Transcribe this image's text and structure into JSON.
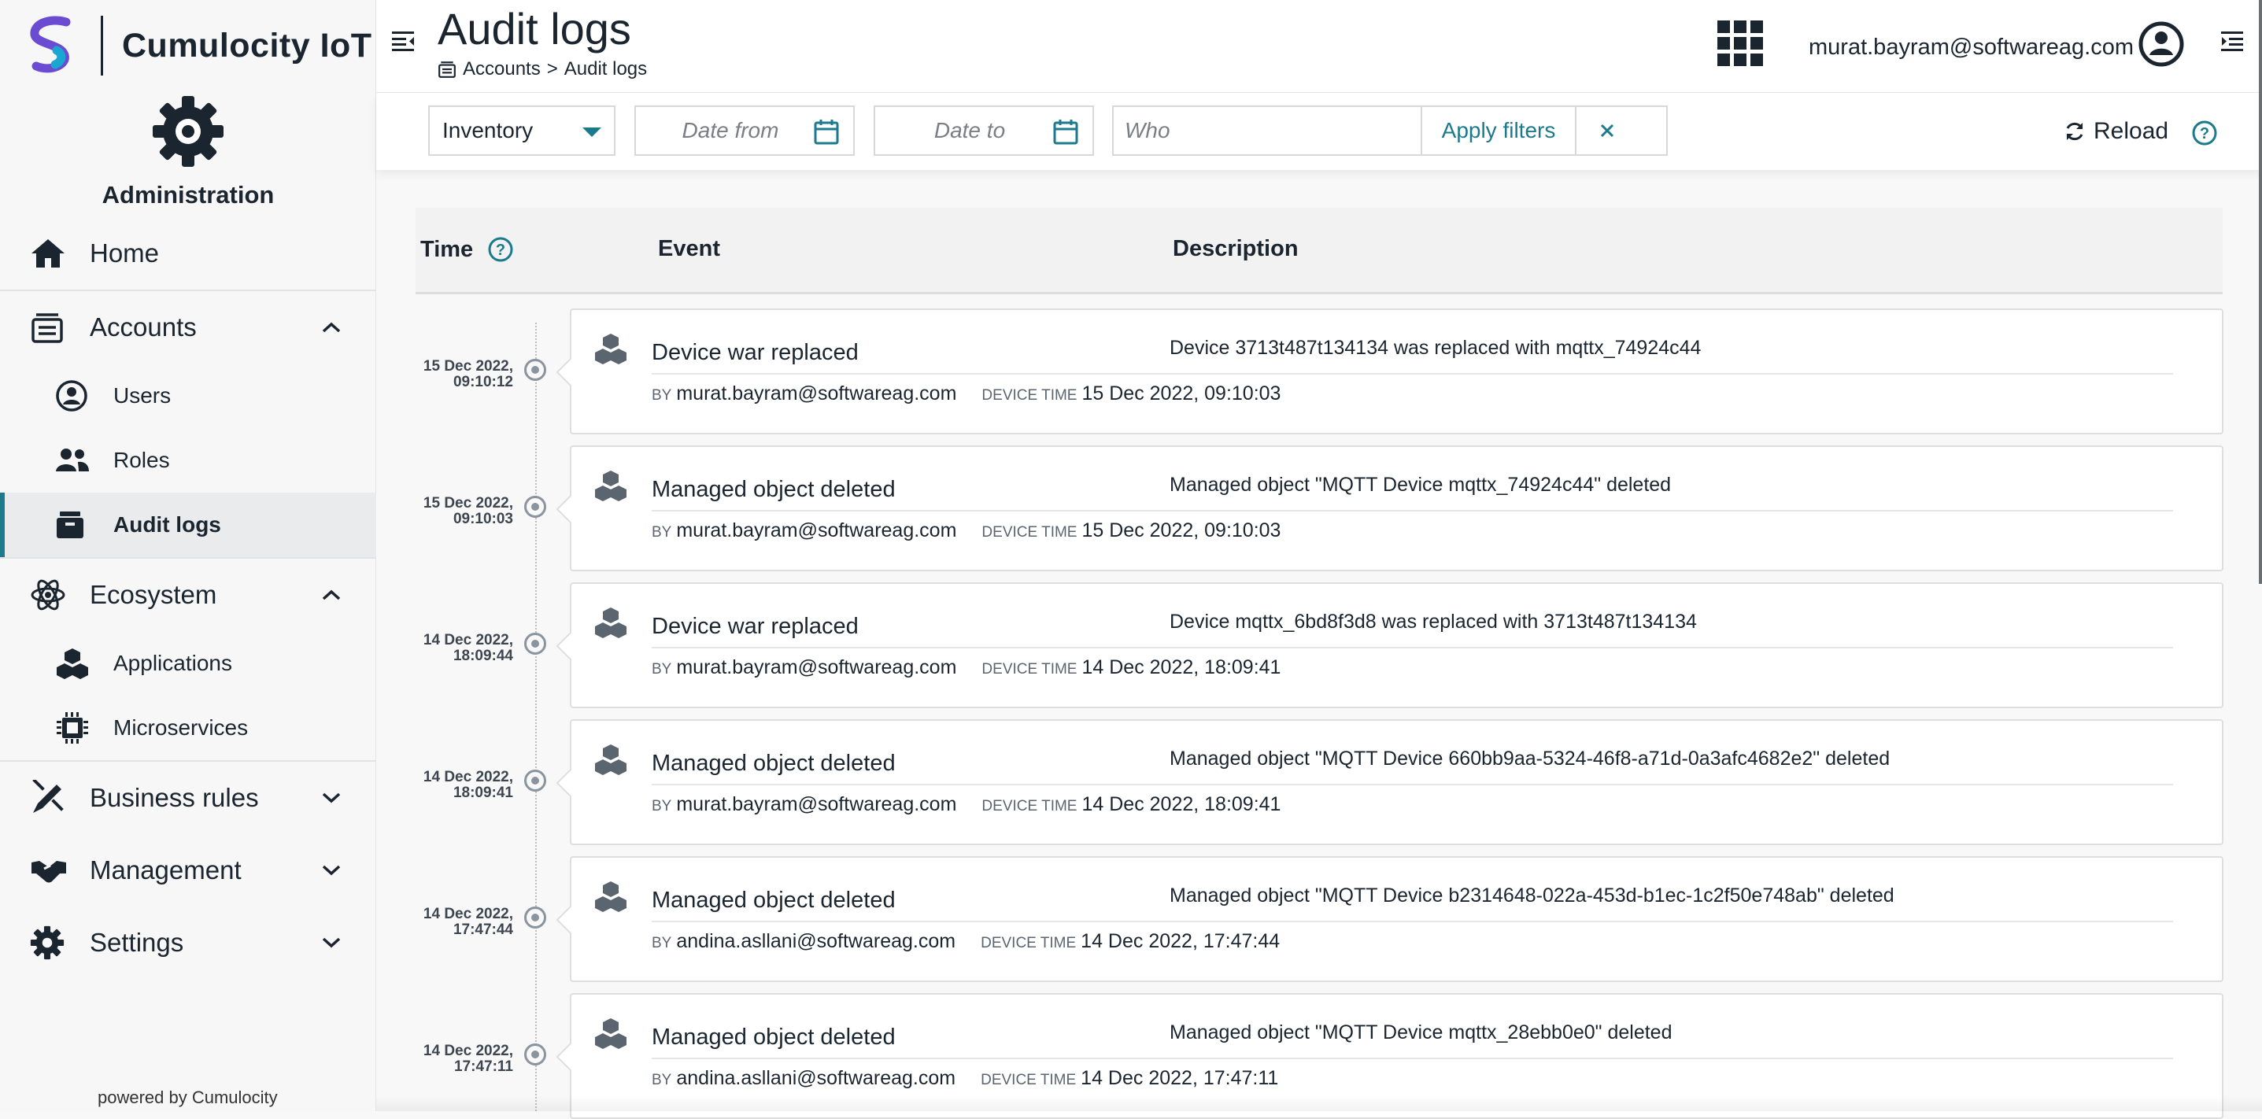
{
  "brand": {
    "name": "Cumulocity IoT",
    "app_name": "Administration",
    "powered_by": "powered by Cumulocity"
  },
  "nav": {
    "home": "Home",
    "accounts": "Accounts",
    "users": "Users",
    "roles": "Roles",
    "audit_logs": "Audit logs",
    "ecosystem": "Ecosystem",
    "applications": "Applications",
    "microservices": "Microservices",
    "business_rules": "Business rules",
    "management": "Management",
    "settings": "Settings"
  },
  "header": {
    "title": "Audit logs",
    "breadcrumb_parent": "Accounts",
    "breadcrumb_sep": ">",
    "breadcrumb_current": "Audit logs",
    "user_email": "murat.bayram@softwareag.com"
  },
  "filters": {
    "type_value": "Inventory",
    "date_from_placeholder": "Date from",
    "date_to_placeholder": "Date to",
    "who_placeholder": "Who",
    "apply_label": "Apply filters",
    "reload_label": "Reload"
  },
  "table": {
    "col_time": "Time",
    "col_event": "Event",
    "col_description": "Description",
    "by_label": "BY",
    "device_time_label": "DEVICE TIME",
    "rows": [
      {
        "date": "15 Dec 2022,",
        "time": "09:10:12",
        "event": "Device war replaced",
        "description": "Device 3713t487t134134 was replaced with mqttx_74924c44",
        "by": "murat.bayram@softwareag.com",
        "device_time": "15 Dec 2022, 09:10:03"
      },
      {
        "date": "15 Dec 2022,",
        "time": "09:10:03",
        "event": "Managed object deleted",
        "description": "Managed object \"MQTT Device mqttx_74924c44\" deleted",
        "by": "murat.bayram@softwareag.com",
        "device_time": "15 Dec 2022, 09:10:03"
      },
      {
        "date": "14 Dec 2022,",
        "time": "18:09:44",
        "event": "Device war replaced",
        "description": "Device mqttx_6bd8f3d8 was replaced with 3713t487t134134",
        "by": "murat.bayram@softwareag.com",
        "device_time": "14 Dec 2022, 18:09:41"
      },
      {
        "date": "14 Dec 2022,",
        "time": "18:09:41",
        "event": "Managed object deleted",
        "description": "Managed object \"MQTT Device 660bb9aa-5324-46f8-a71d-0a3afc4682e2\" deleted",
        "by": "murat.bayram@softwareag.com",
        "device_time": "14 Dec 2022, 18:09:41"
      },
      {
        "date": "14 Dec 2022,",
        "time": "17:47:44",
        "event": "Managed object deleted",
        "description": "Managed object \"MQTT Device b2314648-022a-453d-b1ec-1c2f50e748ab\" deleted",
        "by": "andina.asllani@softwareag.com",
        "device_time": "14 Dec 2022, 17:47:44"
      },
      {
        "date": "14 Dec 2022,",
        "time": "17:47:11",
        "event": "Managed object deleted",
        "description": "Managed object \"MQTT Device mqttx_28ebb0e0\" deleted",
        "by": "andina.asllani@softwareag.com",
        "device_time": "14 Dec 2022, 17:47:11"
      }
    ]
  },
  "colors": {
    "accent": "#1b7a8c",
    "text": "#1b2530",
    "sidebar_bg": "#f7f7f7",
    "brand_purple": "#6a4bd1",
    "brand_blue": "#1aa6d1"
  }
}
